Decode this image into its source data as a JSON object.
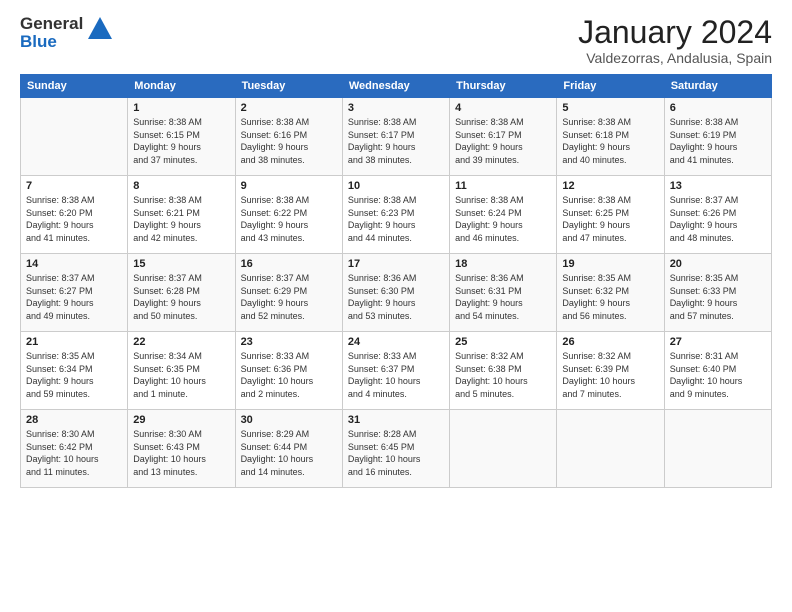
{
  "header": {
    "logo_line1": "General",
    "logo_line2": "Blue",
    "month": "January 2024",
    "location": "Valdezorras, Andalusia, Spain"
  },
  "columns": [
    "Sunday",
    "Monday",
    "Tuesday",
    "Wednesday",
    "Thursday",
    "Friday",
    "Saturday"
  ],
  "weeks": [
    [
      {
        "day": "",
        "lines": []
      },
      {
        "day": "1",
        "lines": [
          "Sunrise: 8:38 AM",
          "Sunset: 6:15 PM",
          "Daylight: 9 hours",
          "and 37 minutes."
        ]
      },
      {
        "day": "2",
        "lines": [
          "Sunrise: 8:38 AM",
          "Sunset: 6:16 PM",
          "Daylight: 9 hours",
          "and 38 minutes."
        ]
      },
      {
        "day": "3",
        "lines": [
          "Sunrise: 8:38 AM",
          "Sunset: 6:17 PM",
          "Daylight: 9 hours",
          "and 38 minutes."
        ]
      },
      {
        "day": "4",
        "lines": [
          "Sunrise: 8:38 AM",
          "Sunset: 6:17 PM",
          "Daylight: 9 hours",
          "and 39 minutes."
        ]
      },
      {
        "day": "5",
        "lines": [
          "Sunrise: 8:38 AM",
          "Sunset: 6:18 PM",
          "Daylight: 9 hours",
          "and 40 minutes."
        ]
      },
      {
        "day": "6",
        "lines": [
          "Sunrise: 8:38 AM",
          "Sunset: 6:19 PM",
          "Daylight: 9 hours",
          "and 41 minutes."
        ]
      }
    ],
    [
      {
        "day": "7",
        "lines": [
          "Sunrise: 8:38 AM",
          "Sunset: 6:20 PM",
          "Daylight: 9 hours",
          "and 41 minutes."
        ]
      },
      {
        "day": "8",
        "lines": [
          "Sunrise: 8:38 AM",
          "Sunset: 6:21 PM",
          "Daylight: 9 hours",
          "and 42 minutes."
        ]
      },
      {
        "day": "9",
        "lines": [
          "Sunrise: 8:38 AM",
          "Sunset: 6:22 PM",
          "Daylight: 9 hours",
          "and 43 minutes."
        ]
      },
      {
        "day": "10",
        "lines": [
          "Sunrise: 8:38 AM",
          "Sunset: 6:23 PM",
          "Daylight: 9 hours",
          "and 44 minutes."
        ]
      },
      {
        "day": "11",
        "lines": [
          "Sunrise: 8:38 AM",
          "Sunset: 6:24 PM",
          "Daylight: 9 hours",
          "and 46 minutes."
        ]
      },
      {
        "day": "12",
        "lines": [
          "Sunrise: 8:38 AM",
          "Sunset: 6:25 PM",
          "Daylight: 9 hours",
          "and 47 minutes."
        ]
      },
      {
        "day": "13",
        "lines": [
          "Sunrise: 8:37 AM",
          "Sunset: 6:26 PM",
          "Daylight: 9 hours",
          "and 48 minutes."
        ]
      }
    ],
    [
      {
        "day": "14",
        "lines": [
          "Sunrise: 8:37 AM",
          "Sunset: 6:27 PM",
          "Daylight: 9 hours",
          "and 49 minutes."
        ]
      },
      {
        "day": "15",
        "lines": [
          "Sunrise: 8:37 AM",
          "Sunset: 6:28 PM",
          "Daylight: 9 hours",
          "and 50 minutes."
        ]
      },
      {
        "day": "16",
        "lines": [
          "Sunrise: 8:37 AM",
          "Sunset: 6:29 PM",
          "Daylight: 9 hours",
          "and 52 minutes."
        ]
      },
      {
        "day": "17",
        "lines": [
          "Sunrise: 8:36 AM",
          "Sunset: 6:30 PM",
          "Daylight: 9 hours",
          "and 53 minutes."
        ]
      },
      {
        "day": "18",
        "lines": [
          "Sunrise: 8:36 AM",
          "Sunset: 6:31 PM",
          "Daylight: 9 hours",
          "and 54 minutes."
        ]
      },
      {
        "day": "19",
        "lines": [
          "Sunrise: 8:35 AM",
          "Sunset: 6:32 PM",
          "Daylight: 9 hours",
          "and 56 minutes."
        ]
      },
      {
        "day": "20",
        "lines": [
          "Sunrise: 8:35 AM",
          "Sunset: 6:33 PM",
          "Daylight: 9 hours",
          "and 57 minutes."
        ]
      }
    ],
    [
      {
        "day": "21",
        "lines": [
          "Sunrise: 8:35 AM",
          "Sunset: 6:34 PM",
          "Daylight: 9 hours",
          "and 59 minutes."
        ]
      },
      {
        "day": "22",
        "lines": [
          "Sunrise: 8:34 AM",
          "Sunset: 6:35 PM",
          "Daylight: 10 hours",
          "and 1 minute."
        ]
      },
      {
        "day": "23",
        "lines": [
          "Sunrise: 8:33 AM",
          "Sunset: 6:36 PM",
          "Daylight: 10 hours",
          "and 2 minutes."
        ]
      },
      {
        "day": "24",
        "lines": [
          "Sunrise: 8:33 AM",
          "Sunset: 6:37 PM",
          "Daylight: 10 hours",
          "and 4 minutes."
        ]
      },
      {
        "day": "25",
        "lines": [
          "Sunrise: 8:32 AM",
          "Sunset: 6:38 PM",
          "Daylight: 10 hours",
          "and 5 minutes."
        ]
      },
      {
        "day": "26",
        "lines": [
          "Sunrise: 8:32 AM",
          "Sunset: 6:39 PM",
          "Daylight: 10 hours",
          "and 7 minutes."
        ]
      },
      {
        "day": "27",
        "lines": [
          "Sunrise: 8:31 AM",
          "Sunset: 6:40 PM",
          "Daylight: 10 hours",
          "and 9 minutes."
        ]
      }
    ],
    [
      {
        "day": "28",
        "lines": [
          "Sunrise: 8:30 AM",
          "Sunset: 6:42 PM",
          "Daylight: 10 hours",
          "and 11 minutes."
        ]
      },
      {
        "day": "29",
        "lines": [
          "Sunrise: 8:30 AM",
          "Sunset: 6:43 PM",
          "Daylight: 10 hours",
          "and 13 minutes."
        ]
      },
      {
        "day": "30",
        "lines": [
          "Sunrise: 8:29 AM",
          "Sunset: 6:44 PM",
          "Daylight: 10 hours",
          "and 14 minutes."
        ]
      },
      {
        "day": "31",
        "lines": [
          "Sunrise: 8:28 AM",
          "Sunset: 6:45 PM",
          "Daylight: 10 hours",
          "and 16 minutes."
        ]
      },
      {
        "day": "",
        "lines": []
      },
      {
        "day": "",
        "lines": []
      },
      {
        "day": "",
        "lines": []
      }
    ]
  ]
}
